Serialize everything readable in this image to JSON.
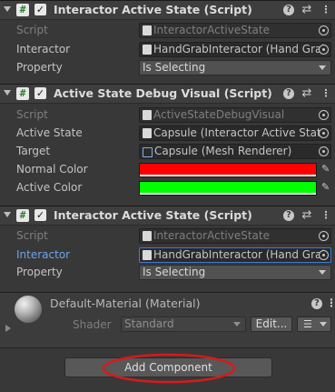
{
  "components": [
    {
      "title": "Interactor Active State (Script)",
      "rows": {
        "script": {
          "label": "Script",
          "value": "InteractorActiveState"
        },
        "interactor": {
          "label": "Interactor",
          "value": "HandGrabInteractor (Hand Grab"
        },
        "property": {
          "label": "Property",
          "value": "Is Selecting"
        }
      }
    },
    {
      "title": "Active State Debug Visual (Script)",
      "rows": {
        "script": {
          "label": "Script",
          "value": "ActiveStateDebugVisual"
        },
        "active_state": {
          "label": "Active State",
          "value": "Capsule (Interactor Active State"
        },
        "target": {
          "label": "Target",
          "value": "Capsule (Mesh Renderer)"
        },
        "normal_color": {
          "label": "Normal Color",
          "color": "#ff0000"
        },
        "active_color": {
          "label": "Active Color",
          "color": "#00ff00"
        }
      }
    },
    {
      "title": "Interactor Active State (Script)",
      "rows": {
        "script": {
          "label": "Script",
          "value": "InteractorActiveState"
        },
        "interactor": {
          "label": "Interactor",
          "value": "HandGrabInteractor (Hand Grab"
        },
        "property": {
          "label": "Property",
          "value": "Is Selecting"
        }
      }
    }
  ],
  "material": {
    "title": "Default-Material (Material)",
    "shader_label": "Shader",
    "shader_value": "Standard",
    "edit_label": "Edit..."
  },
  "icons": {
    "script": "#",
    "check": "✓",
    "help": "?",
    "preset": "⇄",
    "menu": "⋮",
    "eyedropper": "✎",
    "list": "☰"
  },
  "add_component_label": "Add Component",
  "annotation_color": "#d41b1b"
}
